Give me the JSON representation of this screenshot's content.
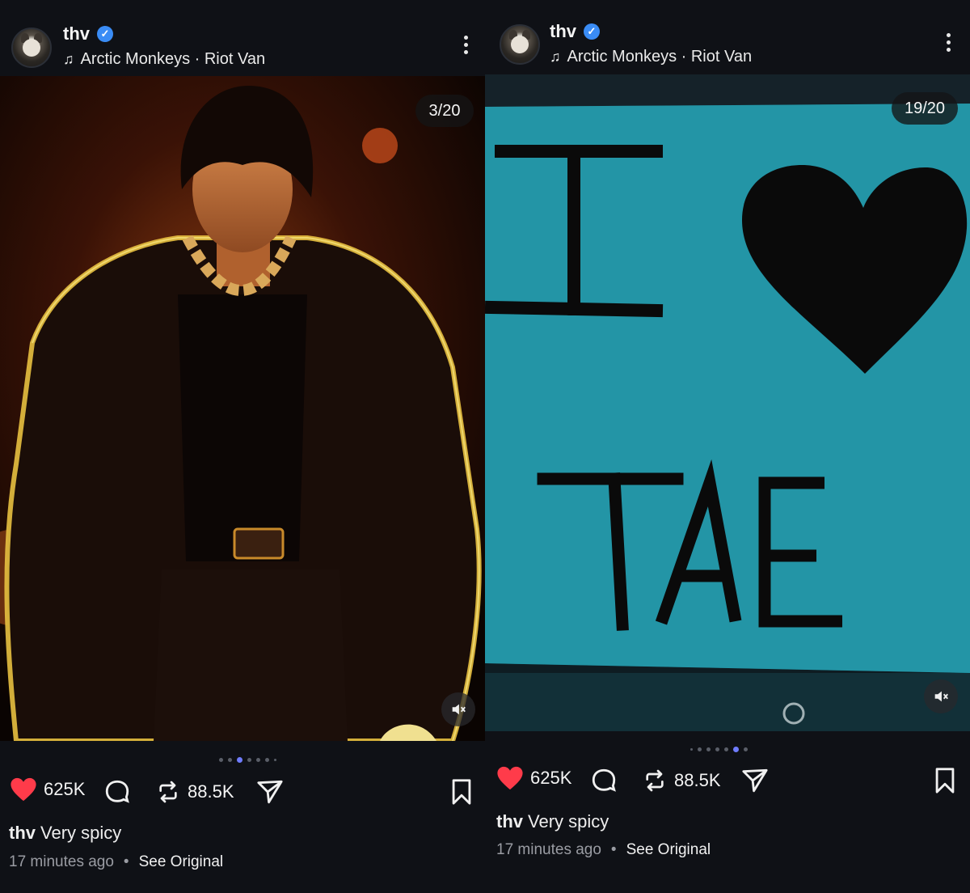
{
  "posts": [
    {
      "username": "thv",
      "music": "Arctic Monkeys · Riot Van",
      "counter": "3/20",
      "likes": "625K",
      "reposts": "88.5K",
      "caption_user": "thv",
      "caption_text": "Very spicy",
      "time": "17 minutes ago",
      "see_original": "See Original",
      "dots_total": 7,
      "dots_active": 2
    },
    {
      "username": "thv",
      "music": "Arctic Monkeys · Riot Van",
      "counter": "19/20",
      "likes": "625K",
      "reposts": "88.5K",
      "caption_user": "thv",
      "caption_text": "Very spicy",
      "time": "17 minutes ago",
      "see_original": "See Original",
      "sign_line1": "I",
      "sign_line2": "TAE",
      "dots_total": 7,
      "dots_active": 5
    }
  ],
  "colors": {
    "like": "#ff3b4a",
    "accent": "#6f7cff",
    "verified": "#3a8cf5",
    "sign_bg": "#1f8fa0"
  },
  "icons": [
    "music-note-icon",
    "verified-icon",
    "more-icon",
    "mute-icon",
    "heart-icon",
    "comment-icon",
    "repost-icon",
    "share-icon",
    "bookmark-icon"
  ]
}
